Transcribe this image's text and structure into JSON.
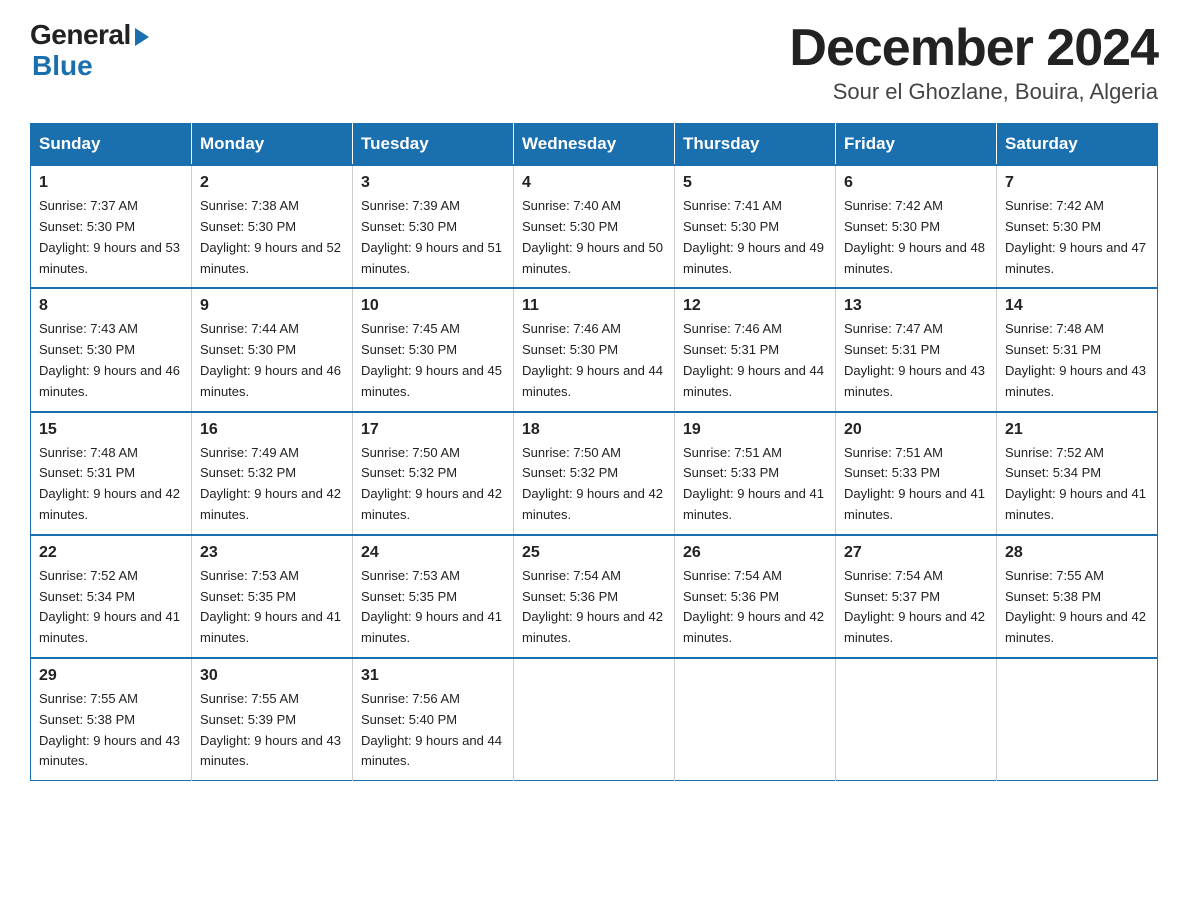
{
  "logo": {
    "general": "General",
    "blue": "Blue"
  },
  "title": "December 2024",
  "subtitle": "Sour el Ghozlane, Bouira, Algeria",
  "days_of_week": [
    "Sunday",
    "Monday",
    "Tuesday",
    "Wednesday",
    "Thursday",
    "Friday",
    "Saturday"
  ],
  "weeks": [
    [
      {
        "day": "1",
        "sunrise": "7:37 AM",
        "sunset": "5:30 PM",
        "daylight": "9 hours and 53 minutes."
      },
      {
        "day": "2",
        "sunrise": "7:38 AM",
        "sunset": "5:30 PM",
        "daylight": "9 hours and 52 minutes."
      },
      {
        "day": "3",
        "sunrise": "7:39 AM",
        "sunset": "5:30 PM",
        "daylight": "9 hours and 51 minutes."
      },
      {
        "day": "4",
        "sunrise": "7:40 AM",
        "sunset": "5:30 PM",
        "daylight": "9 hours and 50 minutes."
      },
      {
        "day": "5",
        "sunrise": "7:41 AM",
        "sunset": "5:30 PM",
        "daylight": "9 hours and 49 minutes."
      },
      {
        "day": "6",
        "sunrise": "7:42 AM",
        "sunset": "5:30 PM",
        "daylight": "9 hours and 48 minutes."
      },
      {
        "day": "7",
        "sunrise": "7:42 AM",
        "sunset": "5:30 PM",
        "daylight": "9 hours and 47 minutes."
      }
    ],
    [
      {
        "day": "8",
        "sunrise": "7:43 AM",
        "sunset": "5:30 PM",
        "daylight": "9 hours and 46 minutes."
      },
      {
        "day": "9",
        "sunrise": "7:44 AM",
        "sunset": "5:30 PM",
        "daylight": "9 hours and 46 minutes."
      },
      {
        "day": "10",
        "sunrise": "7:45 AM",
        "sunset": "5:30 PM",
        "daylight": "9 hours and 45 minutes."
      },
      {
        "day": "11",
        "sunrise": "7:46 AM",
        "sunset": "5:30 PM",
        "daylight": "9 hours and 44 minutes."
      },
      {
        "day": "12",
        "sunrise": "7:46 AM",
        "sunset": "5:31 PM",
        "daylight": "9 hours and 44 minutes."
      },
      {
        "day": "13",
        "sunrise": "7:47 AM",
        "sunset": "5:31 PM",
        "daylight": "9 hours and 43 minutes."
      },
      {
        "day": "14",
        "sunrise": "7:48 AM",
        "sunset": "5:31 PM",
        "daylight": "9 hours and 43 minutes."
      }
    ],
    [
      {
        "day": "15",
        "sunrise": "7:48 AM",
        "sunset": "5:31 PM",
        "daylight": "9 hours and 42 minutes."
      },
      {
        "day": "16",
        "sunrise": "7:49 AM",
        "sunset": "5:32 PM",
        "daylight": "9 hours and 42 minutes."
      },
      {
        "day": "17",
        "sunrise": "7:50 AM",
        "sunset": "5:32 PM",
        "daylight": "9 hours and 42 minutes."
      },
      {
        "day": "18",
        "sunrise": "7:50 AM",
        "sunset": "5:32 PM",
        "daylight": "9 hours and 42 minutes."
      },
      {
        "day": "19",
        "sunrise": "7:51 AM",
        "sunset": "5:33 PM",
        "daylight": "9 hours and 41 minutes."
      },
      {
        "day": "20",
        "sunrise": "7:51 AM",
        "sunset": "5:33 PM",
        "daylight": "9 hours and 41 minutes."
      },
      {
        "day": "21",
        "sunrise": "7:52 AM",
        "sunset": "5:34 PM",
        "daylight": "9 hours and 41 minutes."
      }
    ],
    [
      {
        "day": "22",
        "sunrise": "7:52 AM",
        "sunset": "5:34 PM",
        "daylight": "9 hours and 41 minutes."
      },
      {
        "day": "23",
        "sunrise": "7:53 AM",
        "sunset": "5:35 PM",
        "daylight": "9 hours and 41 minutes."
      },
      {
        "day": "24",
        "sunrise": "7:53 AM",
        "sunset": "5:35 PM",
        "daylight": "9 hours and 41 minutes."
      },
      {
        "day": "25",
        "sunrise": "7:54 AM",
        "sunset": "5:36 PM",
        "daylight": "9 hours and 42 minutes."
      },
      {
        "day": "26",
        "sunrise": "7:54 AM",
        "sunset": "5:36 PM",
        "daylight": "9 hours and 42 minutes."
      },
      {
        "day": "27",
        "sunrise": "7:54 AM",
        "sunset": "5:37 PM",
        "daylight": "9 hours and 42 minutes."
      },
      {
        "day": "28",
        "sunrise": "7:55 AM",
        "sunset": "5:38 PM",
        "daylight": "9 hours and 42 minutes."
      }
    ],
    [
      {
        "day": "29",
        "sunrise": "7:55 AM",
        "sunset": "5:38 PM",
        "daylight": "9 hours and 43 minutes."
      },
      {
        "day": "30",
        "sunrise": "7:55 AM",
        "sunset": "5:39 PM",
        "daylight": "9 hours and 43 minutes."
      },
      {
        "day": "31",
        "sunrise": "7:56 AM",
        "sunset": "5:40 PM",
        "daylight": "9 hours and 44 minutes."
      },
      null,
      null,
      null,
      null
    ]
  ]
}
